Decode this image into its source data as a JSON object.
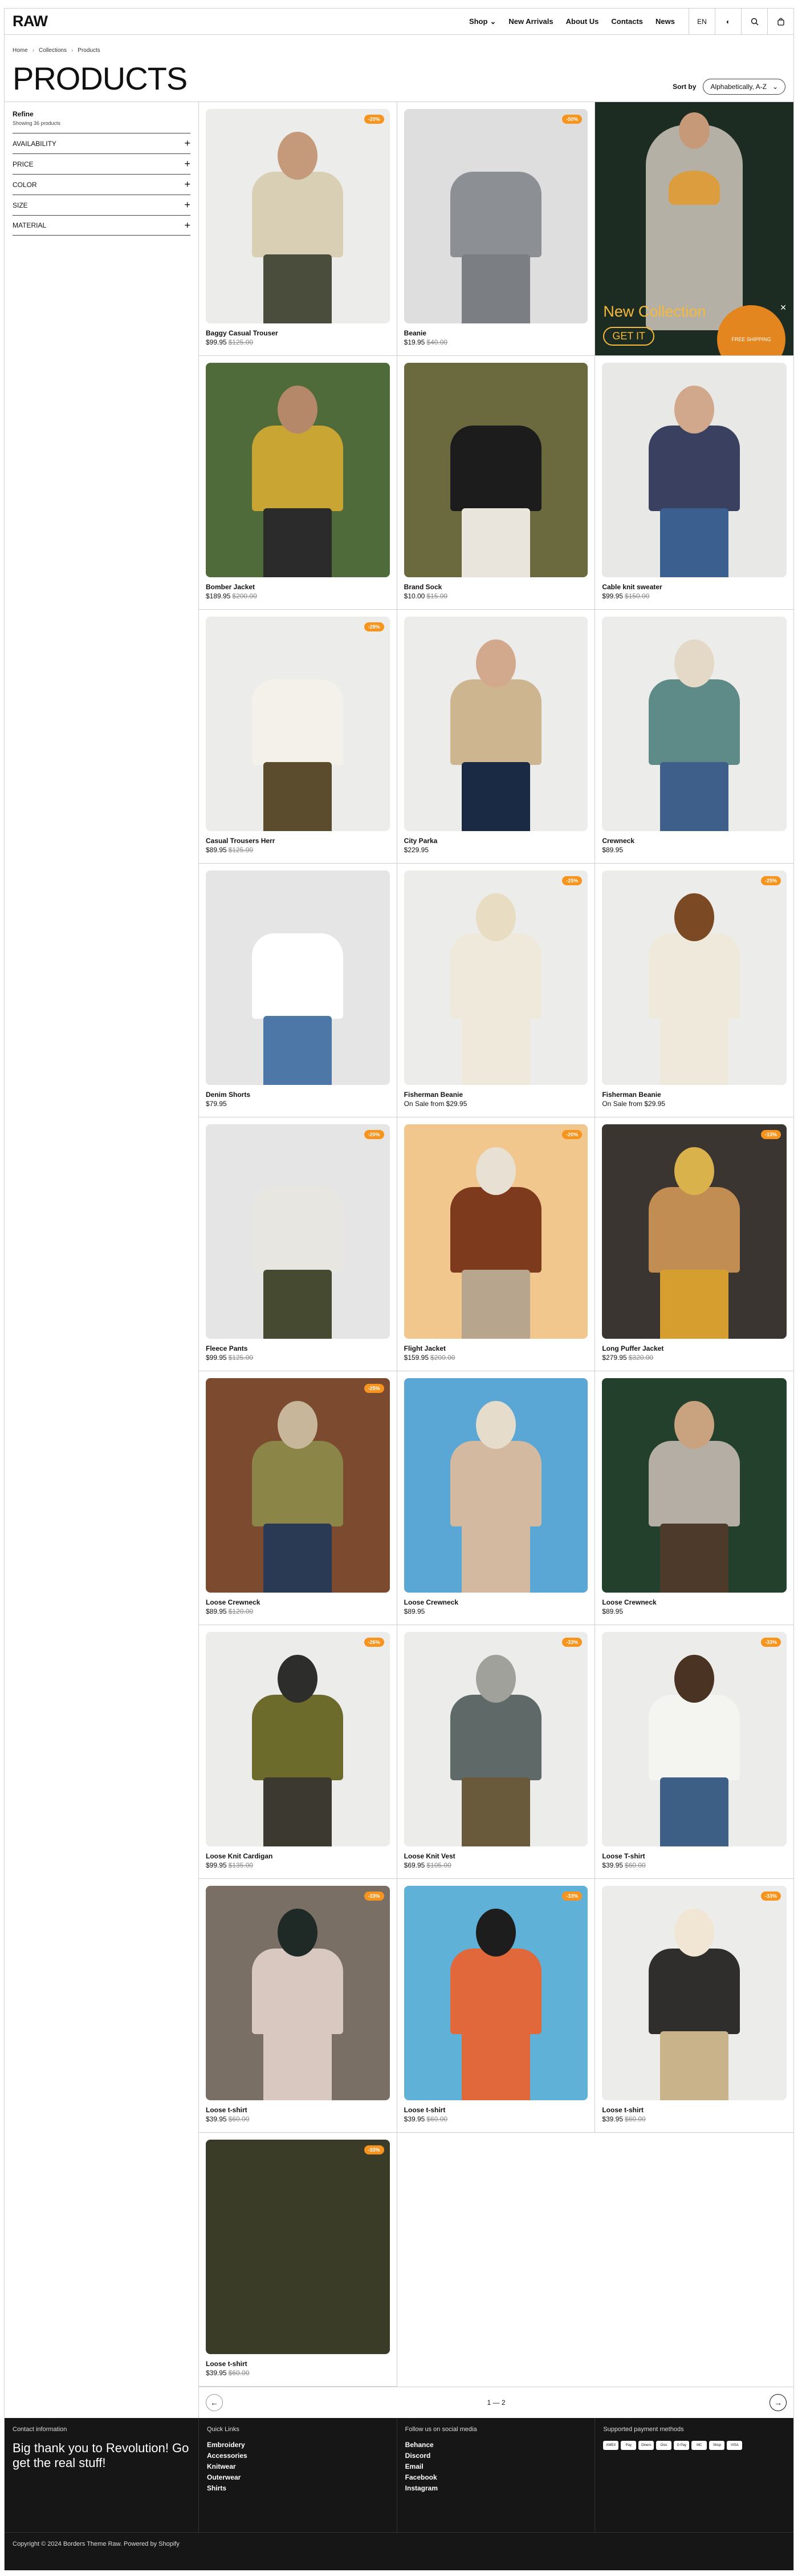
{
  "header": {
    "logo": "RAW",
    "nav": [
      "Shop",
      "New Arrivals",
      "About Us",
      "Contacts",
      "News"
    ],
    "lang": "EN"
  },
  "breadcrumb": [
    "Home",
    "Collections",
    "Products"
  ],
  "page_title": "PRODUCTS",
  "sort": {
    "label": "Sort by",
    "value": "Alphabetically, A-Z"
  },
  "sidebar": {
    "title": "Refine",
    "showing": "Showing 36 products",
    "filters": [
      "AVAILABILITY",
      "PRICE",
      "COLOR",
      "SIZE",
      "MATERIAL"
    ]
  },
  "promo": {
    "title": "New Collection",
    "button": "GET IT",
    "badge": "FREE SHIPPING"
  },
  "products": [
    {
      "name": "Baggy Casual Trouser",
      "price": "$99.95",
      "was": "$125.00",
      "badge": "-20%"
    },
    {
      "name": "Beanie",
      "price": "$19.95",
      "was": "$40.00",
      "badge": "-50%"
    },
    {
      "name": "Bomber Jacket",
      "price": "$189.95",
      "was": "$200.00",
      "badge": ""
    },
    {
      "name": "Brand Sock",
      "price": "$10.00",
      "was": "$15.00",
      "badge": ""
    },
    {
      "name": "Cable knit sweater",
      "price": "$99.95",
      "was": "$150.00",
      "badge": ""
    },
    {
      "name": "Casual Trousers Herr",
      "price": "$89.95",
      "was": "$125.00",
      "badge": "-28%"
    },
    {
      "name": "City Parka",
      "price": "$229.95",
      "was": "",
      "badge": ""
    },
    {
      "name": "Crewneck",
      "price": "$89.95",
      "was": "",
      "badge": ""
    },
    {
      "name": "Denim Shorts",
      "price": "$79.95",
      "was": "",
      "badge": ""
    },
    {
      "name": "Fisherman Beanie",
      "price": "On Sale from $29.95",
      "was": "",
      "badge": "-25%"
    },
    {
      "name": "Fisherman Beanie",
      "price": "On Sale from $29.95",
      "was": "",
      "badge": "-25%"
    },
    {
      "name": "Fleece Pants",
      "price": "$99.95",
      "was": "$125.00",
      "badge": "-20%"
    },
    {
      "name": "Flight Jacket",
      "price": "$159.95",
      "was": "$200.00",
      "badge": "-20%"
    },
    {
      "name": "Long Puffer Jacket",
      "price": "$279.95",
      "was": "$320.00",
      "badge": "-13%"
    },
    {
      "name": "Loose Crewneck",
      "price": "$89.95",
      "was": "$120.00",
      "badge": "-25%"
    },
    {
      "name": "Loose Crewneck",
      "price": "$89.95",
      "was": "",
      "badge": ""
    },
    {
      "name": "Loose Crewneck",
      "price": "$89.95",
      "was": "",
      "badge": ""
    },
    {
      "name": "Loose Knit Cardigan",
      "price": "$99.95",
      "was": "$135.00",
      "badge": "-26%"
    },
    {
      "name": "Loose Knit Vest",
      "price": "$69.95",
      "was": "$105.00",
      "badge": "-33%"
    },
    {
      "name": "Loose T-shirt",
      "price": "$39.95",
      "was": "$60.00",
      "badge": "-33%"
    },
    {
      "name": "Loose t-shirt",
      "price": "$39.95",
      "was": "$60.00",
      "badge": "-33%"
    },
    {
      "name": "Loose t-shirt",
      "price": "$39.95",
      "was": "$60.00",
      "badge": "-33%"
    },
    {
      "name": "Loose t-shirt",
      "price": "$39.95",
      "was": "$60.00",
      "badge": "-33%"
    },
    {
      "name": "Loose t-shirt",
      "price": "$39.95",
      "was": "$60.00",
      "badge": "-33%"
    }
  ],
  "pager": {
    "label": "1 — 2"
  },
  "footer": {
    "contact_head": "Contact information",
    "thanks": "Big thank you to Revolution! Go get the real stuff!",
    "quick_head": "Quick Links",
    "quick": [
      "Embroidery",
      "Accessories",
      "Knitwear",
      "Outerwear",
      "Shirts"
    ],
    "social_head": "Follow us on social media",
    "social": [
      "Behance",
      "Discord",
      "Email",
      "Facebook",
      "Instagram"
    ],
    "pay_head": "Supported payment methods",
    "pays": [
      "AMEX",
      "Pay",
      "Diners",
      "Disc",
      "G Pay",
      "MC",
      "Shop",
      "VISA"
    ],
    "copyright": "Copyright © 2024 Borders Theme Raw. Powered by Shopify"
  },
  "colors": {
    "accent": "#f7941d",
    "footer": "#161616",
    "promo": "#1d2c22"
  }
}
